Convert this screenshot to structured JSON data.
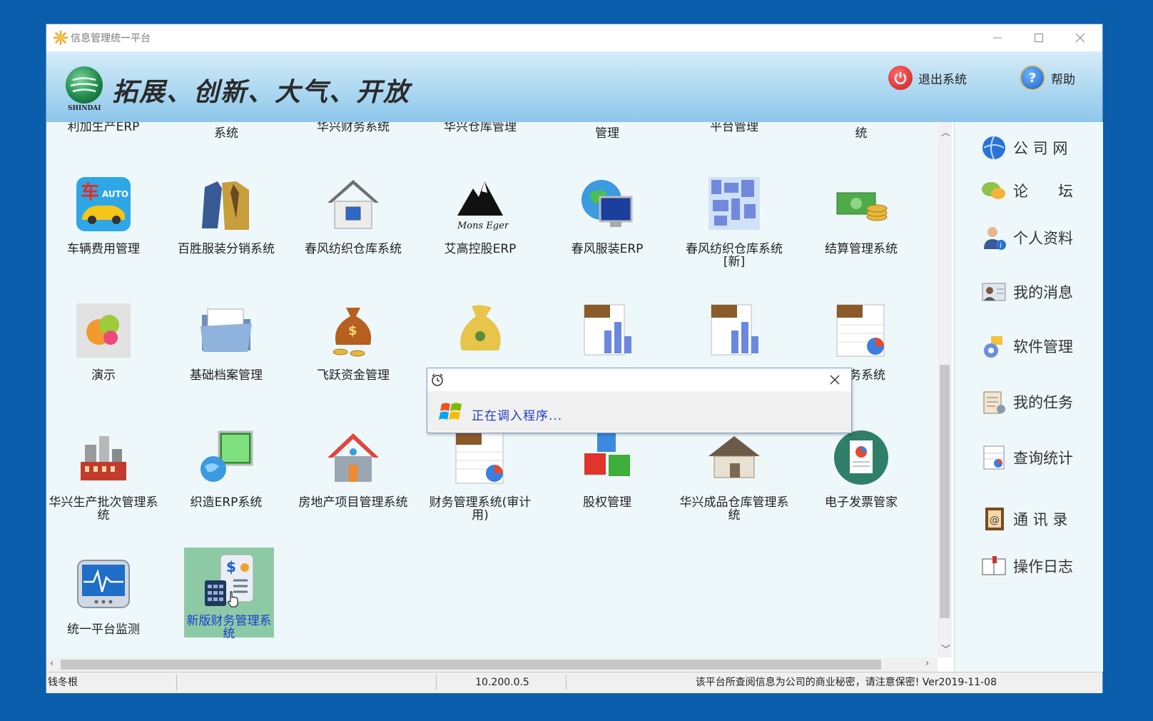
{
  "window": {
    "title": "信息管理统一平台"
  },
  "banner": {
    "logo_text": "SHINDAI",
    "slogan": "拓展、创新、大气、开放",
    "exit_label": "退出系统",
    "help_label": "帮助"
  },
  "cut_row": [
    "利加生产ERP",
    "系统",
    "华兴财务系统",
    "华兴仓库管理",
    "管理",
    "平台管理",
    "统"
  ],
  "apps": [
    {
      "label": "车辆费用管理",
      "icon": "car-icon"
    },
    {
      "label": "百胜服装分销系统",
      "icon": "clothing-icon"
    },
    {
      "label": "春风纺织仓库系统",
      "icon": "house-icon"
    },
    {
      "label": "艾高控股ERP",
      "icon": "mountain-logo-icon"
    },
    {
      "label": "春风服装ERP",
      "icon": "globe-monitor-icon"
    },
    {
      "label": "春风纺织仓库系统[新]",
      "icon": "map-icon"
    },
    {
      "label": "结算管理系统",
      "icon": "cash-coins-icon"
    },
    {
      "label": "演示",
      "icon": "chat-bubbles-icon"
    },
    {
      "label": "基础档案管理",
      "icon": "folder-icon"
    },
    {
      "label": "飞跃资金管理",
      "icon": "money-bag-icon"
    },
    {
      "label": "",
      "icon": "money-bag-icon"
    },
    {
      "label": "",
      "icon": "report-chart-icon"
    },
    {
      "label": "",
      "icon": "report-chart-icon"
    },
    {
      "label": "财务系统",
      "icon": "spreadsheet-pie-icon"
    },
    {
      "label": "华兴生产批次管理系统",
      "icon": "factory-icon"
    },
    {
      "label": "织造ERP系统",
      "icon": "network-monitor-icon"
    },
    {
      "label": "房地产项目管理系统",
      "icon": "home-icon"
    },
    {
      "label": "财务管理系统(审计用)",
      "icon": "spreadsheet-pie-icon"
    },
    {
      "label": "股权管理",
      "icon": "blocks-icon"
    },
    {
      "label": "华兴成品仓库管理系统",
      "icon": "warehouse-icon"
    },
    {
      "label": "电子发票管家",
      "icon": "invoice-icon"
    },
    {
      "label": "统一平台监测",
      "icon": "heartbeat-monitor-icon"
    },
    {
      "label": "新版财务管理系统",
      "icon": "finance-calculator-icon"
    }
  ],
  "sidebar": {
    "items": [
      {
        "label": "公 司 网",
        "icon": "globe-icon"
      },
      {
        "label": "论　　坛",
        "icon": "chat-icon"
      },
      {
        "label": "个人资料",
        "icon": "user-info-icon"
      },
      {
        "label": "我的消息",
        "icon": "message-icon"
      },
      {
        "label": "软件管理",
        "icon": "software-icon"
      },
      {
        "label": "我的任务",
        "icon": "task-icon"
      },
      {
        "label": "查询统计",
        "icon": "report-icon"
      },
      {
        "label": "通 讯 录",
        "icon": "address-book-icon"
      },
      {
        "label": "操作日志",
        "icon": "log-book-icon"
      }
    ]
  },
  "dialog": {
    "message": "正在调入程序..."
  },
  "status": {
    "user": "钱冬根",
    "empty": "",
    "ip": "10.200.0.5",
    "notice": "该平台所查阅信息为公司的商业秘密，请注意保密!  Ver2019-11-08"
  }
}
